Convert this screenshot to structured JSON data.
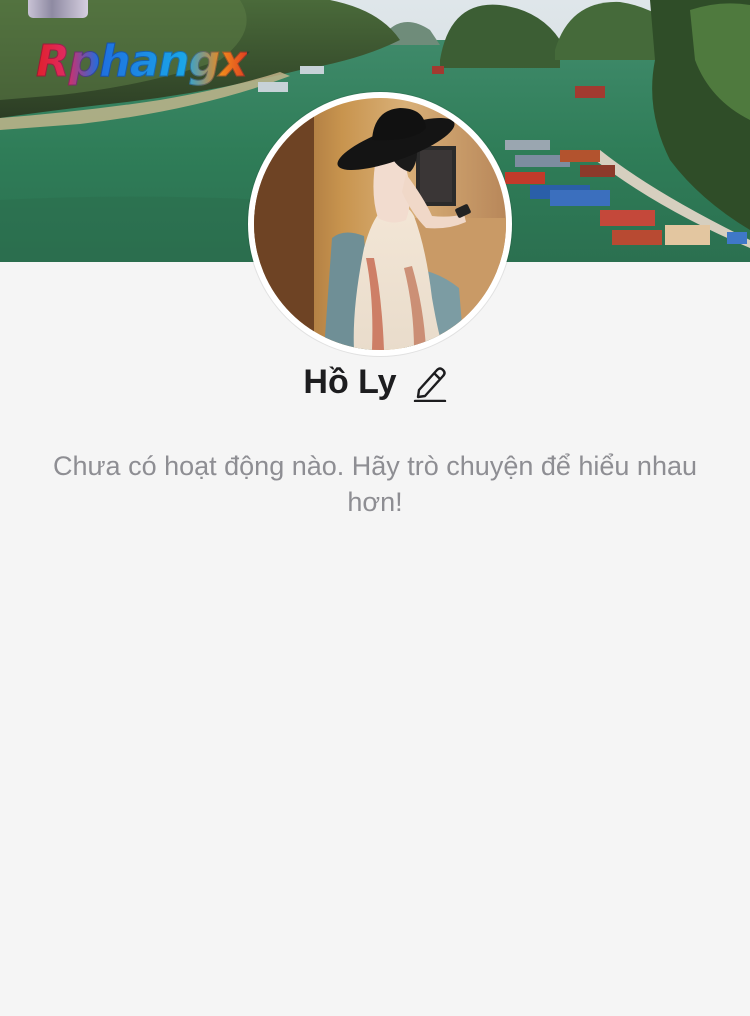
{
  "cover": {
    "logo_text": "Rphangx",
    "image": "ha-long-bay-landscape"
  },
  "profile": {
    "name": "Hồ Ly",
    "avatar": "woman-in-black-hat-photo",
    "edit_icon": "pencil-icon"
  },
  "timeline": {
    "empty_message": "Chưa có hoạt động nào. Hãy trò chuyện để hiểu nhau hơn!"
  },
  "colors": {
    "background": "#f5f5f5",
    "name_text": "#1d1d1f",
    "secondary_text": "#8e8e93"
  }
}
